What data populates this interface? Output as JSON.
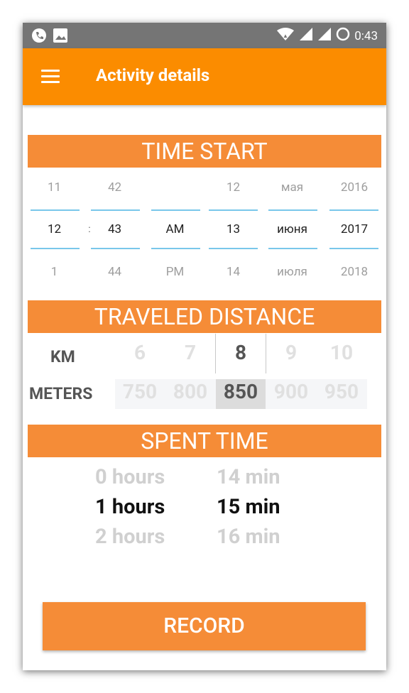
{
  "status_bar": {
    "time": "0:43",
    "icons": [
      "phone-icon",
      "image-icon",
      "wifi-icon",
      "signal-icon",
      "signal-icon",
      "circle-icon"
    ]
  },
  "app_bar": {
    "title": "Activity details",
    "menu_icon": "hamburger-icon"
  },
  "time_start": {
    "header": "TIME START",
    "hour": {
      "prev": "11",
      "selected": "12",
      "next": "1"
    },
    "separator": ":",
    "minute": {
      "prev": "42",
      "selected": "43",
      "next": "44"
    },
    "ampm": {
      "prev": "",
      "selected": "AM",
      "next": "PM"
    },
    "day": {
      "prev": "12",
      "selected": "13",
      "next": "14"
    },
    "month": {
      "prev": "мая",
      "selected": "июня",
      "next": "июля"
    },
    "year": {
      "prev": "2016",
      "selected": "2017",
      "next": "2018"
    }
  },
  "traveled_distance": {
    "header": "TRAVELED DISTANCE",
    "km": {
      "label": "KM",
      "values": [
        "6",
        "7",
        "8",
        "9",
        "10"
      ],
      "selected": "8"
    },
    "meters": {
      "label": "METERS",
      "values": [
        "750",
        "800",
        "850",
        "900",
        "950"
      ],
      "selected": "850"
    }
  },
  "spent_time": {
    "header": "SPENT TIME",
    "hours": {
      "prev": "0 hours",
      "selected": "1 hours",
      "next": "2 hours"
    },
    "minutes": {
      "prev": "14 min",
      "selected": "15 min",
      "next": "16 min"
    }
  },
  "record_button": "RECORD",
  "colors": {
    "accent": "#fb8c00",
    "section": "#f58c37",
    "divider": "#79c7ea"
  }
}
